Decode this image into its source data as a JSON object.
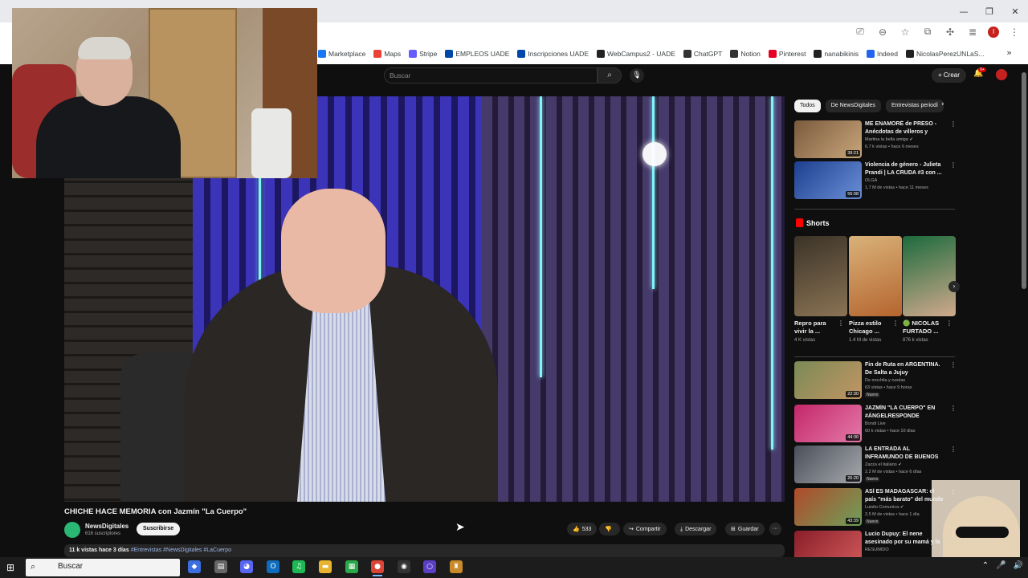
{
  "browser": {
    "window_controls": [
      "—",
      "❐",
      "✕"
    ],
    "bookmarks": [
      {
        "label": "Marketplace",
        "icon": "facebook-icon",
        "color": "#1877f2"
      },
      {
        "label": "Maps",
        "icon": "maps-icon",
        "color": "#ea4335"
      },
      {
        "label": "Stripe",
        "icon": "stripe-icon",
        "color": "#635bff"
      },
      {
        "label": "EMPLEOS UADE",
        "icon": "uade-icon",
        "color": "#0047ab"
      },
      {
        "label": "Inscripciones UADE",
        "icon": "uade-icon",
        "color": "#0047ab"
      },
      {
        "label": "WebCampus2 - UADE",
        "icon": "github-icon",
        "color": "#222222"
      },
      {
        "label": "ChatGPT",
        "icon": "chatgpt-icon",
        "color": "#333333"
      },
      {
        "label": "Notion",
        "icon": "notion-icon",
        "color": "#333333"
      },
      {
        "label": "Pinterest",
        "icon": "pinterest-icon",
        "color": "#e60023"
      },
      {
        "label": "nanabikinis",
        "icon": "github-icon",
        "color": "#222222"
      },
      {
        "label": "Indeed",
        "icon": "indeed-icon",
        "color": "#2164f3"
      },
      {
        "label": "NicolasPerezUNLaS...",
        "icon": "github-icon",
        "color": "#222222"
      }
    ]
  },
  "youtube": {
    "search_placeholder": "Buscar",
    "create_label": "Crear",
    "notifications_badge": "9+",
    "video": {
      "title": "CHICHE HACE MEMORIA con Jazmín \"La Cuerpo\"",
      "channel": "NewsDigitales",
      "subscribers": "616 suscriptores",
      "subscribe_label": "Suscribirse",
      "likes": "533",
      "share_label": "Compartir",
      "download_label": "Descargar",
      "save_label": "Guardar",
      "more_label": "···",
      "views_date": "11 k vistas  hace 3 días",
      "hashtags": "#Entrevistas #NewsDigitales #LaCuerpo"
    },
    "chips": [
      {
        "label": "Todos",
        "active": true
      },
      {
        "label": "De NewsDigitales",
        "active": false
      },
      {
        "label": "Entrevistas periodí",
        "active": false
      }
    ],
    "recs_top": [
      {
        "title": "ME ENAMORÉ de PRESO - Anécdotas de villeros y presos",
        "channel": "Martina la bella amiga ✔",
        "meta": "6,7 k vistas • hace 6 meses",
        "duration": "39:21",
        "colors": [
          "#7a5a3e",
          "#c9a67a"
        ]
      },
      {
        "title": "Violencia de género - Julieta Prandi | LA CRUDA #3 con ...",
        "channel": "OLGA",
        "meta": "1,7 M de vistas • hace 11 meses",
        "duration": "56:08",
        "colors": [
          "#1d3f8f",
          "#6a8fd6"
        ]
      }
    ],
    "shorts_heading": "Shorts",
    "shorts": [
      {
        "title": "Repro para vivir la ...",
        "views": "4 K vistas",
        "colors": [
          "#3b3328",
          "#8a7354"
        ]
      },
      {
        "title": "Pizza estilo Chicago ...",
        "views": "1.4 M de vistas",
        "colors": [
          "#d9b27a",
          "#b5652e"
        ]
      },
      {
        "title": "🟢 NICOLAS FURTADO ...",
        "views": "876 k vistas",
        "colors": [
          "#1c6b3d",
          "#d0a98c"
        ]
      }
    ],
    "recs_bottom": [
      {
        "title": "Fin de Ruta en ARGENTINA. De Salta a Jujuy",
        "channel": "De mochila y ruedas",
        "meta": "63 vistas • hace 9 horas",
        "duration": "22:30",
        "badge": "Nuevo",
        "colors": [
          "#7a8a55",
          "#c29565"
        ]
      },
      {
        "title": "JAZMÍN \"LA CUERPO\" EN #ÁNGELRESPONDE",
        "channel": "Bondi Live",
        "meta": "60 k vistas • hace 10 días",
        "duration": "44:30",
        "badge": "",
        "colors": [
          "#c4276a",
          "#e37aa8"
        ]
      },
      {
        "title": "LA ENTRADA AL INFRAMUNDO DE BUENOS AIRES - ¡Aquí NO ...",
        "channel": "Zazza el italiano ✔",
        "meta": "2,2 M de vistas • hace 6 días",
        "duration": "26:20",
        "badge": "Nuevo",
        "colors": [
          "#4a4f5a",
          "#a7a9ad"
        ]
      },
      {
        "title": "ASÍ ES MADAGASCAR: el país \"más barato\" del mundo | ...",
        "channel": "Luisito Comunica ✔",
        "meta": "2,5 M de vistas • hace 1 día",
        "duration": "43:39",
        "badge": "Nuevo",
        "colors": [
          "#b04a2a",
          "#6ea05a"
        ]
      },
      {
        "title": "Lucio Dupuy: El nene asesinado por su mamá y la novia",
        "channel": "RESUMIDO",
        "meta": "",
        "duration": "",
        "badge": "",
        "colors": [
          "#8a1e2a",
          "#d05a5a"
        ]
      }
    ]
  },
  "taskbar": {
    "search_label": "Buscar",
    "apps": [
      {
        "name": "copilot-icon",
        "glyph": "◆",
        "color": "#3b6fe0"
      },
      {
        "name": "explorer-files-icon",
        "glyph": "▤",
        "color": "#666666"
      },
      {
        "name": "discord-icon",
        "glyph": "◕",
        "color": "#5865f2"
      },
      {
        "name": "outlook-icon",
        "glyph": "O",
        "color": "#0f6cbd"
      },
      {
        "name": "spotify-icon",
        "glyph": "♫",
        "color": "#1db954"
      },
      {
        "name": "folder-icon",
        "glyph": "▬",
        "color": "#e8b430"
      },
      {
        "name": "calculator-icon",
        "glyph": "▦",
        "color": "#2aa84a"
      },
      {
        "name": "chrome-icon",
        "glyph": "●",
        "color": "#db4437"
      },
      {
        "name": "obs-icon",
        "glyph": "◉",
        "color": "#333333"
      },
      {
        "name": "app-circle-icon",
        "glyph": "○",
        "color": "#5b3fc4"
      },
      {
        "name": "app-tool-icon",
        "glyph": "♜",
        "color": "#c98a2b"
      }
    ],
    "tray": [
      "⌃",
      "🎤",
      "🔊"
    ]
  }
}
